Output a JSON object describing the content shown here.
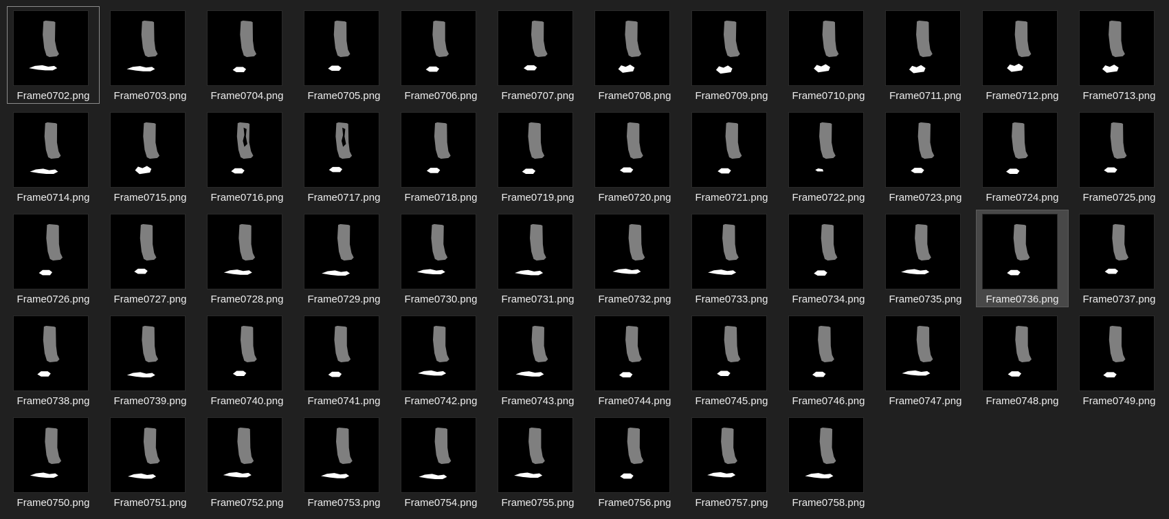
{
  "selected": "Frame0736.png",
  "focused": "Frame0702.png",
  "files": [
    {
      "name": "Frame0702.png",
      "blob": "streak"
    },
    {
      "name": "Frame0703.png",
      "blob": "streak"
    },
    {
      "name": "Frame0704.png",
      "blob": "small"
    },
    {
      "name": "Frame0705.png",
      "blob": "small"
    },
    {
      "name": "Frame0706.png",
      "blob": "small"
    },
    {
      "name": "Frame0707.png",
      "blob": "small"
    },
    {
      "name": "Frame0708.png",
      "blob": "splash"
    },
    {
      "name": "Frame0709.png",
      "blob": "splash"
    },
    {
      "name": "Frame0710.png",
      "blob": "splash"
    },
    {
      "name": "Frame0711.png",
      "blob": "splash"
    },
    {
      "name": "Frame0712.png",
      "blob": "splash"
    },
    {
      "name": "Frame0713.png",
      "blob": "splash"
    },
    {
      "name": "Frame0714.png",
      "blob": "streak"
    },
    {
      "name": "Frame0715.png",
      "blob": "splash"
    },
    {
      "name": "Frame0716.png",
      "blob": "small",
      "holes": true
    },
    {
      "name": "Frame0717.png",
      "blob": "small",
      "holes": true
    },
    {
      "name": "Frame0718.png",
      "blob": "small"
    },
    {
      "name": "Frame0719.png",
      "blob": "small"
    },
    {
      "name": "Frame0720.png",
      "blob": "small"
    },
    {
      "name": "Frame0721.png",
      "blob": "small"
    },
    {
      "name": "Frame0722.png",
      "blob": "tiny"
    },
    {
      "name": "Frame0723.png",
      "blob": "small"
    },
    {
      "name": "Frame0724.png",
      "blob": "small"
    },
    {
      "name": "Frame0725.png",
      "blob": "small"
    },
    {
      "name": "Frame0726.png",
      "blob": "small"
    },
    {
      "name": "Frame0727.png",
      "blob": "small"
    },
    {
      "name": "Frame0728.png",
      "blob": "streak"
    },
    {
      "name": "Frame0729.png",
      "blob": "streak"
    },
    {
      "name": "Frame0730.png",
      "blob": "streak"
    },
    {
      "name": "Frame0731.png",
      "blob": "streak"
    },
    {
      "name": "Frame0732.png",
      "blob": "streak"
    },
    {
      "name": "Frame0733.png",
      "blob": "streak"
    },
    {
      "name": "Frame0734.png",
      "blob": "small"
    },
    {
      "name": "Frame0735.png",
      "blob": "streak"
    },
    {
      "name": "Frame0736.png",
      "blob": "small"
    },
    {
      "name": "Frame0737.png",
      "blob": "small"
    },
    {
      "name": "Frame0738.png",
      "blob": "small"
    },
    {
      "name": "Frame0739.png",
      "blob": "streak"
    },
    {
      "name": "Frame0740.png",
      "blob": "small"
    },
    {
      "name": "Frame0741.png",
      "blob": "small"
    },
    {
      "name": "Frame0742.png",
      "blob": "streak"
    },
    {
      "name": "Frame0743.png",
      "blob": "streak"
    },
    {
      "name": "Frame0744.png",
      "blob": "small"
    },
    {
      "name": "Frame0745.png",
      "blob": "small"
    },
    {
      "name": "Frame0746.png",
      "blob": "small"
    },
    {
      "name": "Frame0747.png",
      "blob": "streak"
    },
    {
      "name": "Frame0748.png",
      "blob": "small"
    },
    {
      "name": "Frame0749.png",
      "blob": "small"
    },
    {
      "name": "Frame0750.png",
      "blob": "streak"
    },
    {
      "name": "Frame0751.png",
      "blob": "streak"
    },
    {
      "name": "Frame0752.png",
      "blob": "streak"
    },
    {
      "name": "Frame0753.png",
      "blob": "streak"
    },
    {
      "name": "Frame0754.png",
      "blob": "streak"
    },
    {
      "name": "Frame0755.png",
      "blob": "streak"
    },
    {
      "name": "Frame0756.png",
      "blob": "small"
    },
    {
      "name": "Frame0757.png",
      "blob": "streak"
    },
    {
      "name": "Frame0758.png",
      "blob": "streak"
    }
  ],
  "colors": {
    "background": "#202020",
    "thumb_background": "#000000",
    "shaft": "#7f7f7f",
    "blob": "#ffffff",
    "selection": "#484848"
  }
}
